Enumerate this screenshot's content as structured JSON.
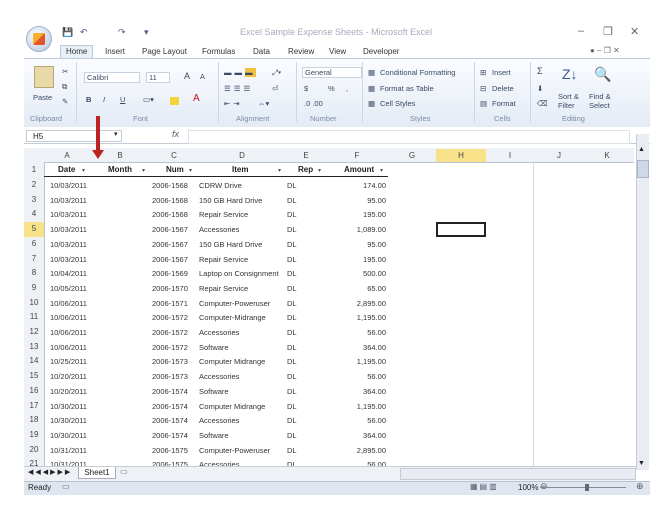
{
  "window": {
    "title": "Excel Sample Expense Sheets - Microsoft Excel",
    "quick_access": [
      "💾",
      "↶",
      "↷",
      "▾"
    ],
    "controls": [
      "–",
      "❐",
      "✕"
    ]
  },
  "tabs": [
    "Home",
    "Insert",
    "Page Layout",
    "Formulas",
    "Data",
    "Review",
    "View",
    "Developer"
  ],
  "ribbon": {
    "clipboard": {
      "paste": "Paste",
      "label": "Clipboard"
    },
    "font": {
      "name": "Calibri",
      "size": "11",
      "bold": "B",
      "italic": "I",
      "underline": "U",
      "label": "Font"
    },
    "alignment": {
      "label": "Alignment"
    },
    "number": {
      "format": "General",
      "currency": "$",
      "percent": "%",
      "comma": ",",
      "label": "Number"
    },
    "styles": {
      "conditional": "Conditional Formatting",
      "format_table": "Format as Table",
      "cell_styles": "Cell Styles",
      "label": "Styles"
    },
    "cells": {
      "insert": "Insert",
      "delete": "Delete",
      "format": "Format",
      "label": "Cells"
    },
    "editing": {
      "sigma": "Σ",
      "sort": "Sort &\nFilter",
      "find": "Find &\nSelect",
      "label": "Editing"
    }
  },
  "formula_bar": {
    "name_box": "H5",
    "fx": "fx",
    "value": ""
  },
  "columns": [
    "A",
    "B",
    "C",
    "D",
    "E",
    "F",
    "G",
    "H",
    "I",
    "J",
    "K"
  ],
  "selected_column": "H",
  "selected_row": "5",
  "table_headers": {
    "date": "Date",
    "month": "Month",
    "num": "Num",
    "item": "Item",
    "rep": "Rep",
    "amount": "Amount"
  },
  "rows": [
    {
      "row": "2",
      "date": "10/03/2011",
      "num": "2006-1568",
      "item": "CDRW Drive",
      "rep": "DL",
      "amount": "174.00"
    },
    {
      "row": "3",
      "date": "10/03/2011",
      "num": "2006-1568",
      "item": "150 GB Hard Drive",
      "rep": "DL",
      "amount": "95.00"
    },
    {
      "row": "4",
      "date": "10/03/2011",
      "num": "2006-1568",
      "item": "Repair Service",
      "rep": "DL",
      "amount": "195.00"
    },
    {
      "row": "5",
      "date": "10/03/2011",
      "num": "2006-1567",
      "item": "Accessories",
      "rep": "DL",
      "amount": "1,089.00"
    },
    {
      "row": "6",
      "date": "10/03/2011",
      "num": "2006-1567",
      "item": "150 GB Hard Drive",
      "rep": "DL",
      "amount": "95.00"
    },
    {
      "row": "7",
      "date": "10/03/2011",
      "num": "2006-1567",
      "item": "Repair Service",
      "rep": "DL",
      "amount": "195.00"
    },
    {
      "row": "8",
      "date": "10/04/2011",
      "num": "2006-1569",
      "item": "Laptop on Consignment",
      "rep": "DL",
      "amount": "500.00"
    },
    {
      "row": "9",
      "date": "10/05/2011",
      "num": "2006-1570",
      "item": "Repair Service",
      "rep": "DL",
      "amount": "65.00"
    },
    {
      "row": "10",
      "date": "10/06/2011",
      "num": "2006-1571",
      "item": "Computer-Poweruser",
      "rep": "DL",
      "amount": "2,895.00"
    },
    {
      "row": "11",
      "date": "10/06/2011",
      "num": "2006-1572",
      "item": "Computer-Midrange",
      "rep": "DL",
      "amount": "1,195.00"
    },
    {
      "row": "12",
      "date": "10/06/2011",
      "num": "2006-1572",
      "item": "Accessories",
      "rep": "DL",
      "amount": "56.00"
    },
    {
      "row": "13",
      "date": "10/06/2011",
      "num": "2006-1572",
      "item": "Software",
      "rep": "DL",
      "amount": "364.00"
    },
    {
      "row": "14",
      "date": "10/25/2011",
      "num": "2006-1573",
      "item": "Computer Midrange",
      "rep": "DL",
      "amount": "1,195.00"
    },
    {
      "row": "15",
      "date": "10/20/2011",
      "num": "2006-1573",
      "item": "Accessories",
      "rep": "DL",
      "amount": "56.00"
    },
    {
      "row": "16",
      "date": "10/20/2011",
      "num": "2006-1574",
      "item": "Software",
      "rep": "DL",
      "amount": "364.00"
    },
    {
      "row": "17",
      "date": "10/30/2011",
      "num": "2006-1574",
      "item": "Computer Midrange",
      "rep": "DL",
      "amount": "1,195.00"
    },
    {
      "row": "18",
      "date": "10/30/2011",
      "num": "2006-1574",
      "item": "Accessories",
      "rep": "DL",
      "amount": "56.00"
    },
    {
      "row": "19",
      "date": "10/30/2011",
      "num": "2006-1574",
      "item": "Software",
      "rep": "DL",
      "amount": "364.00"
    },
    {
      "row": "20",
      "date": "10/31/2011",
      "num": "2006-1575",
      "item": "Computer-Poweruser",
      "rep": "DL",
      "amount": "2,895.00"
    },
    {
      "row": "21",
      "date": "10/31/2011",
      "num": "2006-1575",
      "item": "Accessories",
      "rep": "DL",
      "amount": "56.00"
    }
  ],
  "sheet_tab": "Sheet1",
  "status": {
    "ready": "Ready",
    "zoom": "100%",
    "minus": "⊖",
    "plus": "⊕"
  }
}
